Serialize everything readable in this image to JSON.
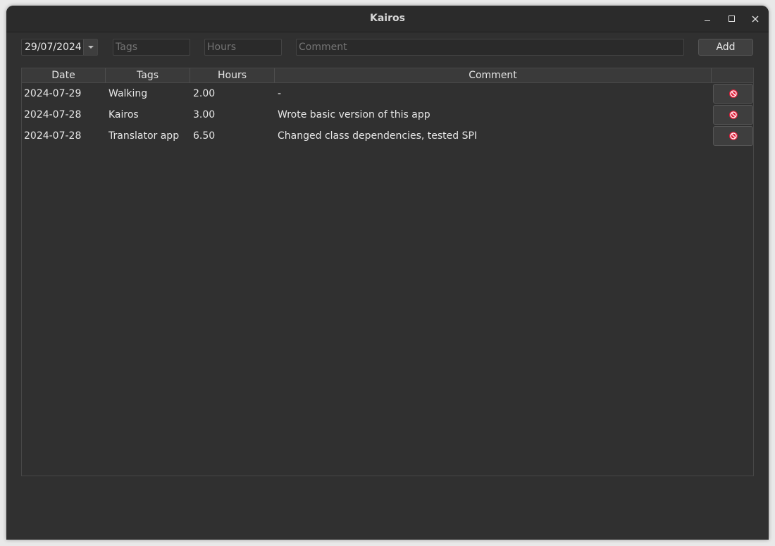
{
  "window": {
    "title": "Kairos"
  },
  "form": {
    "date_value": "29/07/2024",
    "tags_placeholder": "Tags",
    "hours_placeholder": "Hours",
    "comment_placeholder": "Comment",
    "add_label": "Add"
  },
  "table": {
    "columns": [
      "Date",
      "Tags",
      "Hours",
      "Comment",
      ""
    ],
    "rows": [
      {
        "date": "2024-07-29",
        "tags": "Walking",
        "hours": "2.00",
        "comment": "-"
      },
      {
        "date": "2024-07-28",
        "tags": "Kairos",
        "hours": "3.00",
        "comment": "Wrote basic version of this app"
      },
      {
        "date": "2024-07-28",
        "tags": "Translator app",
        "hours": "6.50",
        "comment": "Changed class dependencies, tested SPI"
      }
    ]
  },
  "colors": {
    "window_bg": "#303030",
    "delete_icon": "#e0203c"
  },
  "icons": {
    "delete": "no-entry-icon",
    "dropdown": "chevron-down-icon"
  }
}
